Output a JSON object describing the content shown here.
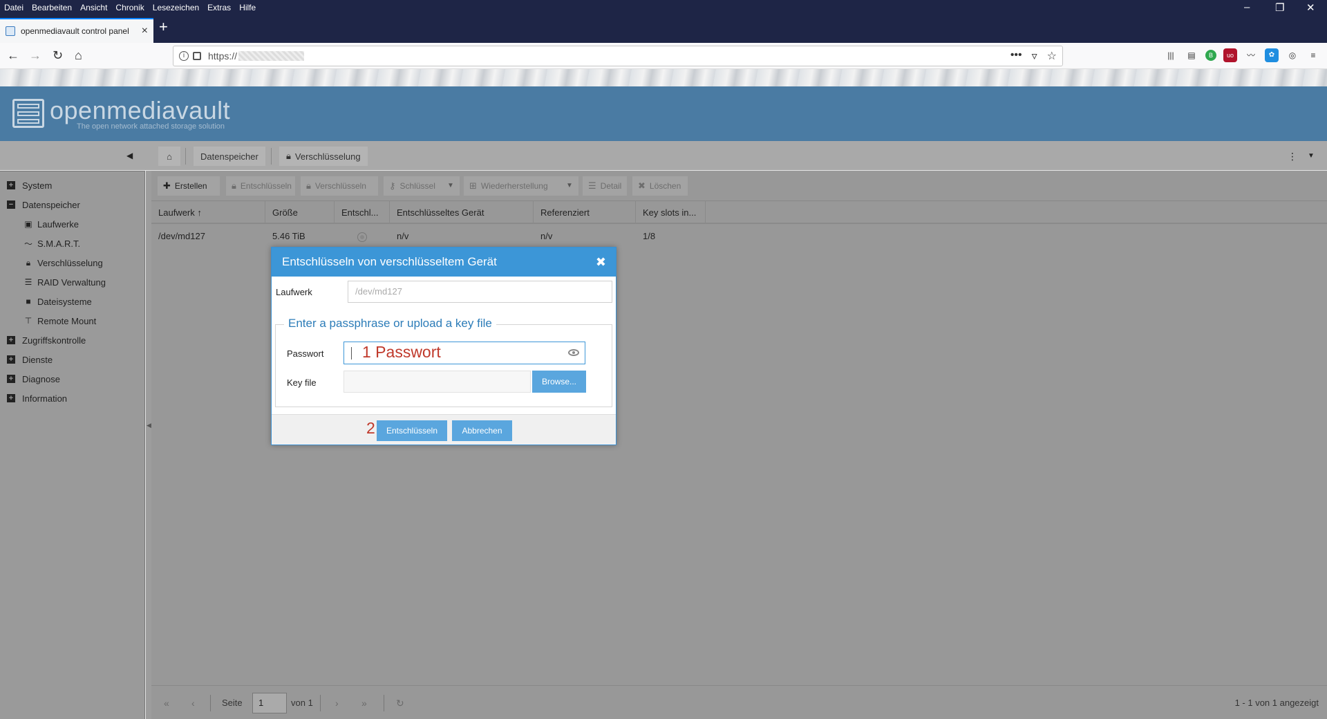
{
  "browser": {
    "menu": [
      "Datei",
      "Bearbeiten",
      "Ansicht",
      "Chronik",
      "Lesezeichen",
      "Extras",
      "Hilfe"
    ],
    "tab_title": "openmediavault control panel",
    "url": "https://"
  },
  "omv": {
    "brand": "openmediavault",
    "tagline": "The open network attached storage solution"
  },
  "breadcrumb": {
    "section": "Datenspeicher",
    "page": "Verschlüsselung"
  },
  "sidebar": {
    "items": [
      {
        "label": "System",
        "type": "group",
        "expanded": false
      },
      {
        "label": "Datenspeicher",
        "type": "group",
        "expanded": true
      },
      {
        "label": "Laufwerke",
        "type": "child",
        "icon": "disk-icon"
      },
      {
        "label": "S.M.A.R.T.",
        "type": "child",
        "icon": "pulse-icon"
      },
      {
        "label": "Verschlüsselung",
        "type": "child",
        "icon": "lock-icon"
      },
      {
        "label": "RAID Verwaltung",
        "type": "child",
        "icon": "database-icon"
      },
      {
        "label": "Dateisysteme",
        "type": "child",
        "icon": "folder-icon"
      },
      {
        "label": "Remote Mount",
        "type": "child",
        "icon": "network-icon"
      },
      {
        "label": "Zugriffskontrolle",
        "type": "group",
        "expanded": false
      },
      {
        "label": "Dienste",
        "type": "group",
        "expanded": false
      },
      {
        "label": "Diagnose",
        "type": "group",
        "expanded": false
      },
      {
        "label": "Information",
        "type": "group",
        "expanded": false
      }
    ]
  },
  "toolbar": {
    "create": "Erstellen",
    "decrypt": "Entschlüsseln",
    "encrypt": "Verschlüsseln",
    "key": "Schlüssel",
    "restore": "Wiederherstellung",
    "detail": "Detail",
    "delete": "Löschen"
  },
  "grid": {
    "columns": [
      "Laufwerk",
      "Größe",
      "Entschl...",
      "Entschlüsseltes Gerät",
      "Referenziert",
      "Key slots in..."
    ],
    "rows": [
      {
        "device": "/dev/md127",
        "size": "5.46 TiB",
        "decrypted_dev": "n/v",
        "referenced": "n/v",
        "key_slots": "1/8"
      }
    ]
  },
  "pager": {
    "page_label": "Seite",
    "page_value": "1",
    "of_label": "von 1",
    "display": "1 - 1 von 1 angezeigt"
  },
  "dialog": {
    "title": "Entschlüsseln von verschlüsseltem Gerät",
    "device_label": "Laufwerk",
    "device_value": "/dev/md127",
    "legend": "Enter a passphrase or upload a key file",
    "password_label": "Passwort",
    "password_annotation": "1 Passwort",
    "keyfile_label": "Key file",
    "browse": "Browse...",
    "step_annotation": "2",
    "decrypt_button": "Entschlüsseln",
    "cancel_button": "Abbrechen"
  },
  "colors": {
    "header": "#4a7ba3",
    "dialog_title": "#3c96d7",
    "button": "#5aa6de",
    "annotation": "#c0392b"
  }
}
